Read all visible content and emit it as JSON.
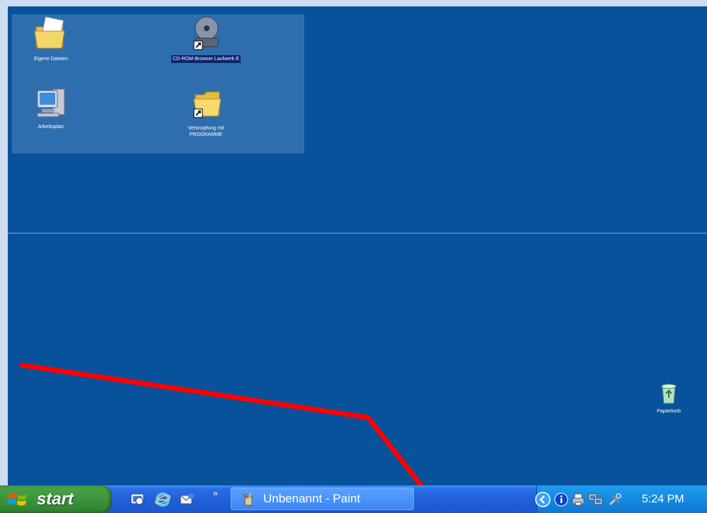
{
  "desktop": {
    "icons": [
      {
        "label": "Eigene Dateien",
        "icon": "my-documents-icon"
      },
      {
        "label": "CD-ROM-Browser Laufwerk E",
        "icon": "cd-drive-shortcut-icon"
      },
      {
        "label": "Arbeitsplatz",
        "icon": "my-computer-icon"
      },
      {
        "label": "Verknüpfung mit PROGRAMME",
        "icon": "folder-shortcut-icon"
      },
      {
        "label": "Papierkorb",
        "icon": "recycle-bin-icon"
      }
    ]
  },
  "taskbar": {
    "start_label": "start",
    "quick_launch": [
      "show-desktop-icon",
      "internet-explorer-icon",
      "outlook-express-icon"
    ],
    "overflow_chevron": "»",
    "task_buttons": [
      {
        "label": "Unbenannt - Paint",
        "icon": "paint-icon"
      }
    ],
    "tray_icons": [
      "show-hidden-icons-icon",
      "info-icon",
      "printer-icon",
      "network-icon",
      "tools-icon"
    ],
    "clock": "5:24 PM"
  },
  "colors": {
    "desktop": "#07529b",
    "taskbar": "#1f5fd8",
    "start_button": "#3c953b",
    "tray": "#1488e0",
    "annotation_arrow": "#ff0000"
  }
}
